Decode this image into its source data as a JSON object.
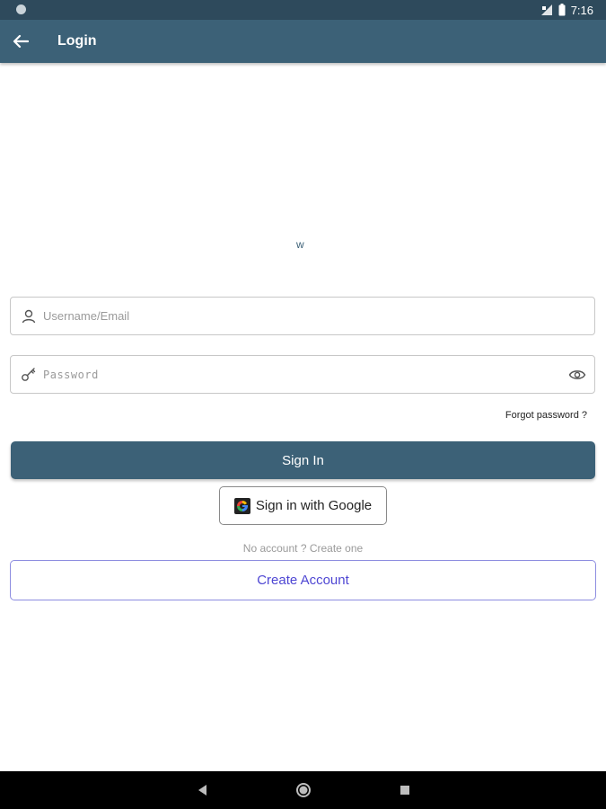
{
  "status_bar": {
    "time": "7:16"
  },
  "app_bar": {
    "title": "Login"
  },
  "logo": {
    "text": "w"
  },
  "form": {
    "username_placeholder": "Username/Email",
    "password_placeholder": "Password",
    "forgot_password": "Forgot password ?"
  },
  "buttons": {
    "sign_in": "Sign In",
    "google_sign_in": "Sign in with Google",
    "no_account": "No account ? Create one",
    "create_account": "Create Account"
  },
  "icons": {
    "back": "arrow-left-icon",
    "username": "person-icon",
    "password": "key-icon",
    "show_password": "eye-icon",
    "google": "google-icon"
  },
  "colors": {
    "status_bar": "#2e4a5c",
    "app_bar": "#3c6177",
    "primary_button": "#3c6177",
    "create_account_text": "#4e46d3",
    "create_account_border": "#8d8de0"
  }
}
